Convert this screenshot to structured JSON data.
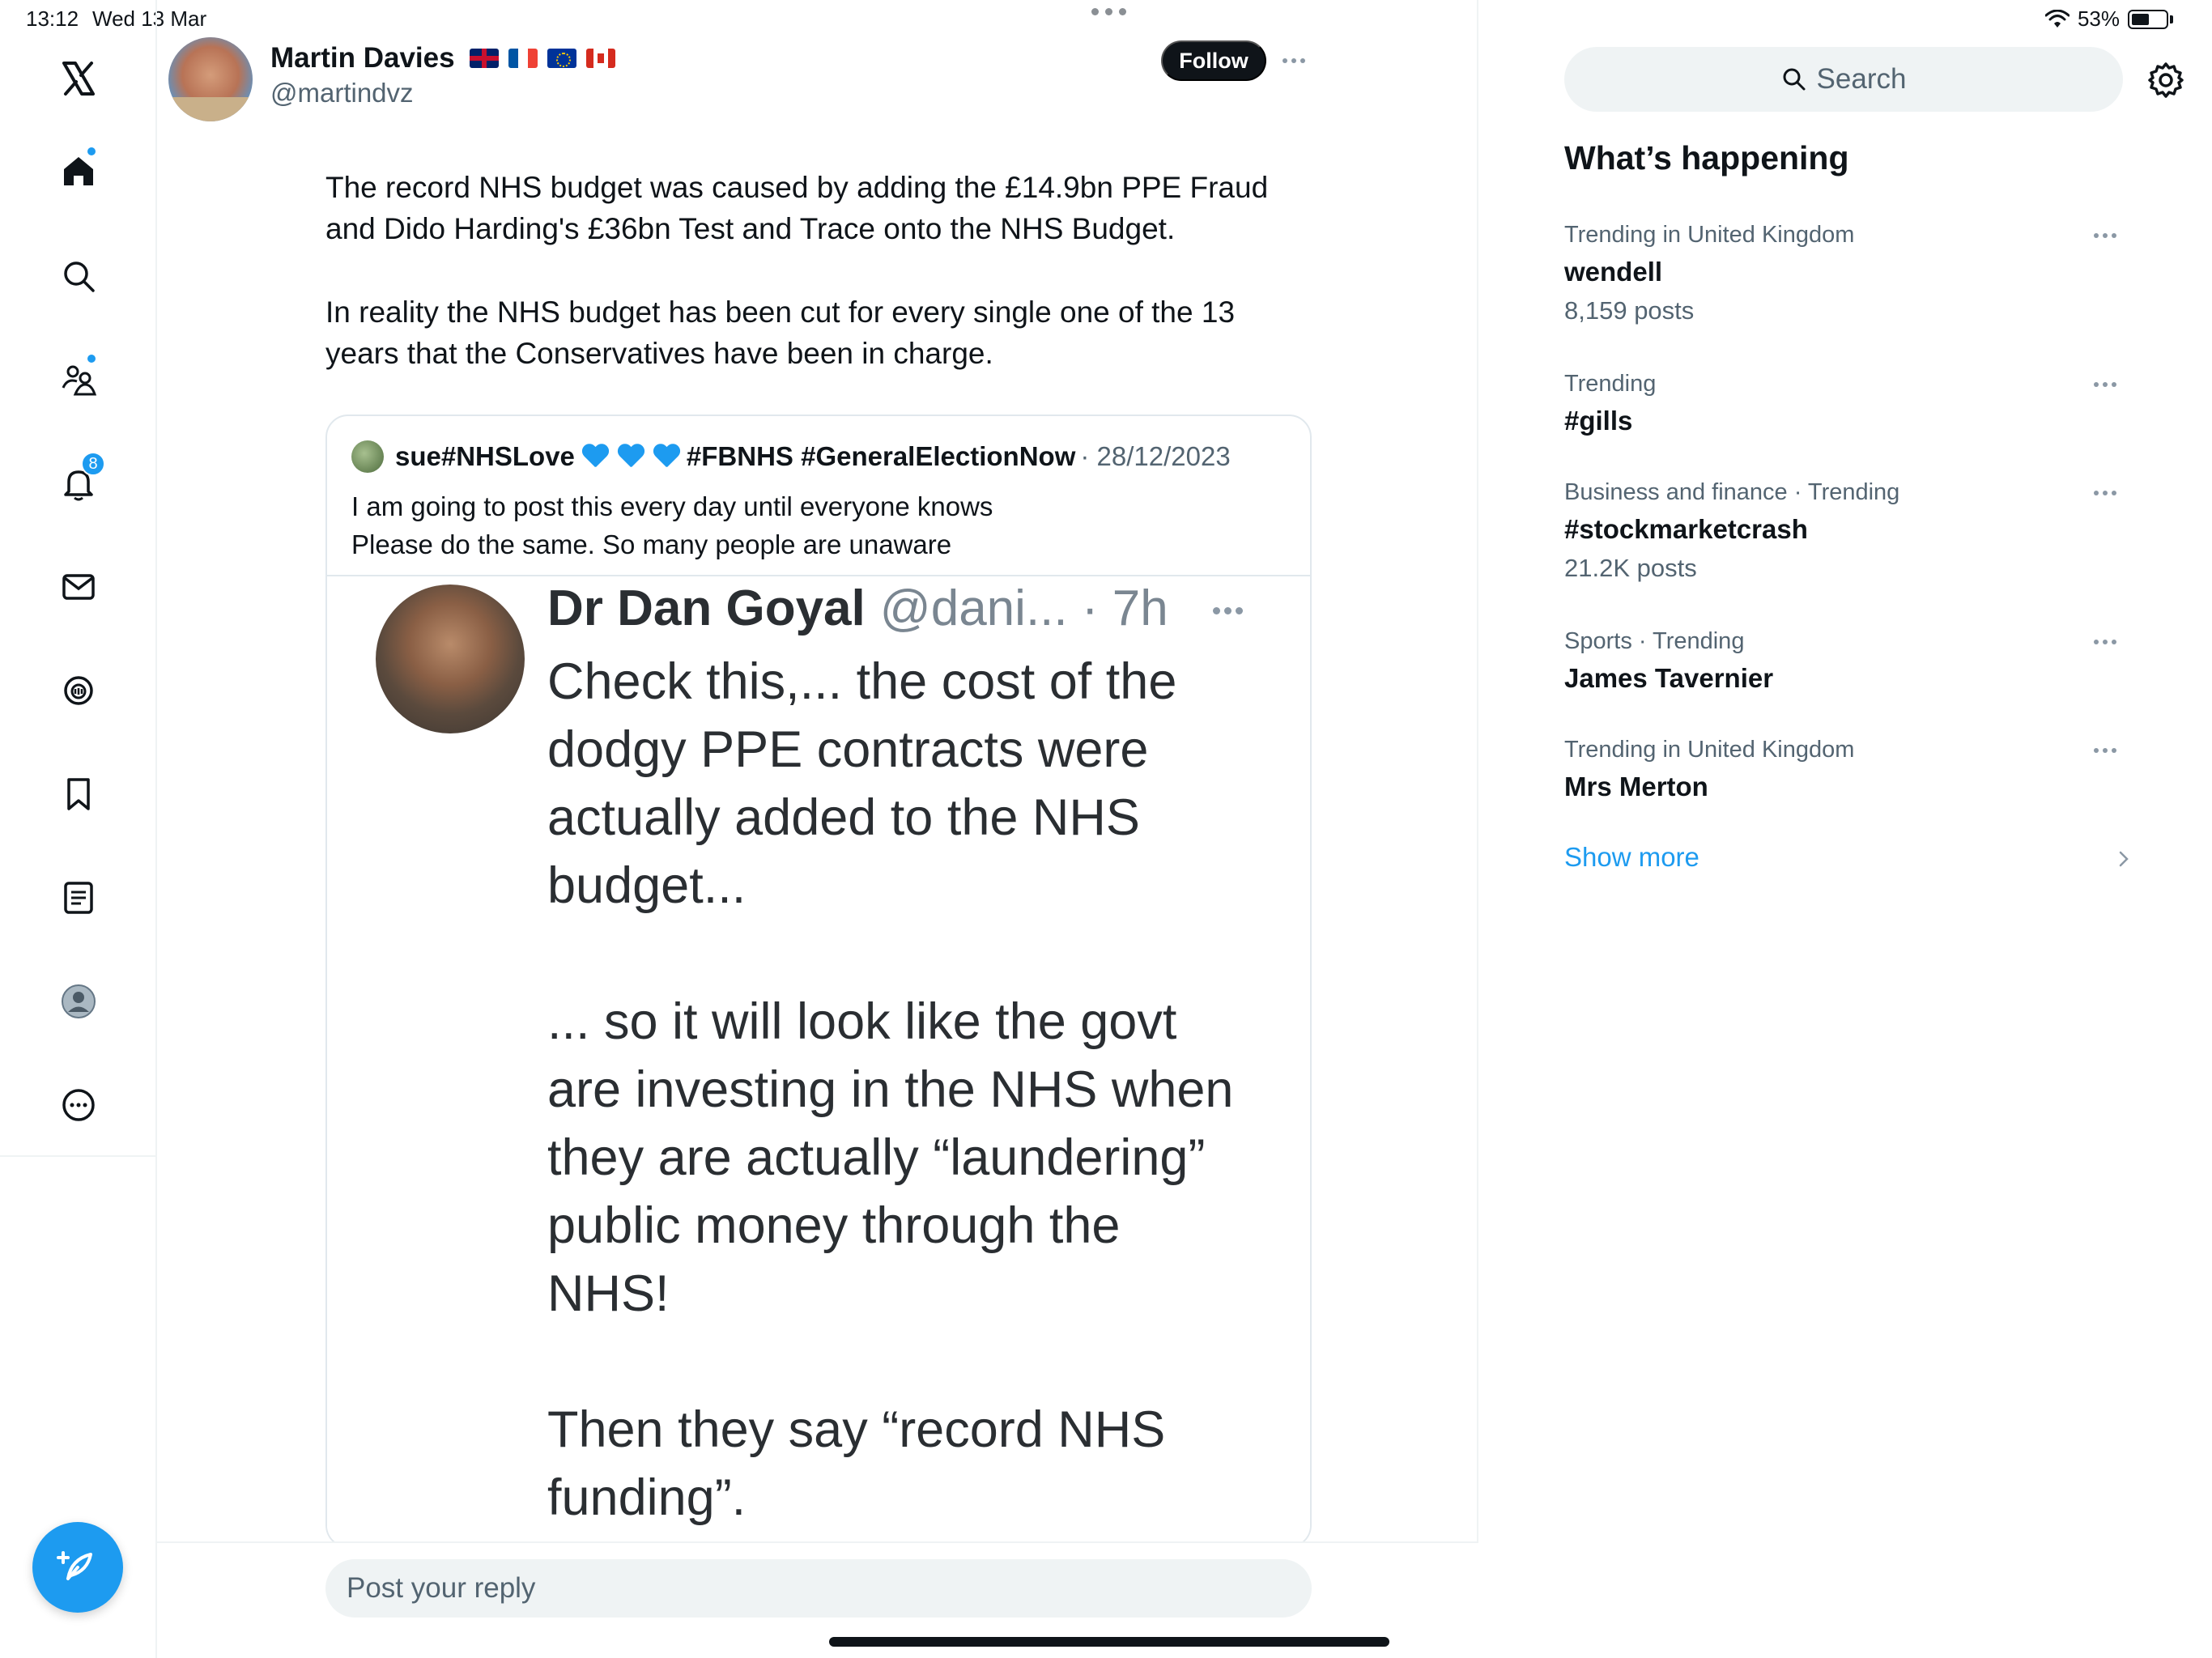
{
  "status_bar": {
    "time": "13:12",
    "date": "Wed 13 Mar",
    "battery_text": "53%",
    "battery_level": 0.53
  },
  "nav": {
    "items": [
      {
        "name": "x-logo-icon"
      },
      {
        "name": "home-icon",
        "has_dot": true
      },
      {
        "name": "explore-icon"
      },
      {
        "name": "communities-icon",
        "has_dot": true
      },
      {
        "name": "notifications-icon",
        "badge": "8"
      },
      {
        "name": "messages-icon"
      },
      {
        "name": "grok-icon"
      },
      {
        "name": "bookmarks-icon"
      },
      {
        "name": "lists-icon"
      },
      {
        "name": "profile-icon"
      },
      {
        "name": "more-icon"
      }
    ],
    "notifications_badge": "8",
    "compose_icon": "compose-feather-icon"
  },
  "tweet": {
    "author_name": "Martin Davies",
    "author_handle": "@martindvz",
    "flags": [
      "uk-flag",
      "france-flag",
      "eu-flag",
      "canada-flag"
    ],
    "follow_label": "Follow",
    "paragraph1": "The record NHS budget was caused by adding the £14.9bn PPE Fraud and Dido Harding's £36bn Test and Trace onto the NHS Budget.",
    "paragraph2": "In reality the NHS budget has been cut for every single one of the 13 years that the Conservatives have been in charge."
  },
  "quote": {
    "author_name": "sue#NHSLove",
    "hashtags": "#FBNHS #GeneralElectionNow",
    "date": "· 28/12/2023",
    "line1": "I am going to post this every day until everyone knows",
    "line2": "Please do the same. So many people are unaware"
  },
  "embedded": {
    "name": "Dr Dan Goyal",
    "handle": "@dani... · 7h",
    "text": "Check this,... the cost of the\ndodgy PPE contracts were\nactually added to the NHS\nbudget...\n\n... so it will look like the govt\nare investing in the NHS when\nthey are actually “laundering”\npublic money through the\nNHS!\n\nThen they say “record NHS\nfunding”."
  },
  "reply": {
    "placeholder": "Post your reply"
  },
  "sidebar": {
    "search_label": "Search",
    "whats_happening": "What’s happening",
    "trends": [
      {
        "context": "Trending in United Kingdom",
        "name": "wendell",
        "posts": "8,159 posts"
      },
      {
        "context": "Trending",
        "name": "#gills",
        "posts": ""
      },
      {
        "context": "Business and finance · Trending",
        "name": "#stockmarketcrash",
        "posts": "21.2K posts"
      },
      {
        "context": "Sports · Trending",
        "name": "James Tavernier",
        "posts": ""
      },
      {
        "context": "Trending in United Kingdom",
        "name": "Mrs Merton",
        "posts": ""
      }
    ],
    "show_more": "Show more"
  },
  "colors": {
    "accent": "#1d9bf0",
    "text": "#0f1419",
    "muted": "#536471"
  }
}
